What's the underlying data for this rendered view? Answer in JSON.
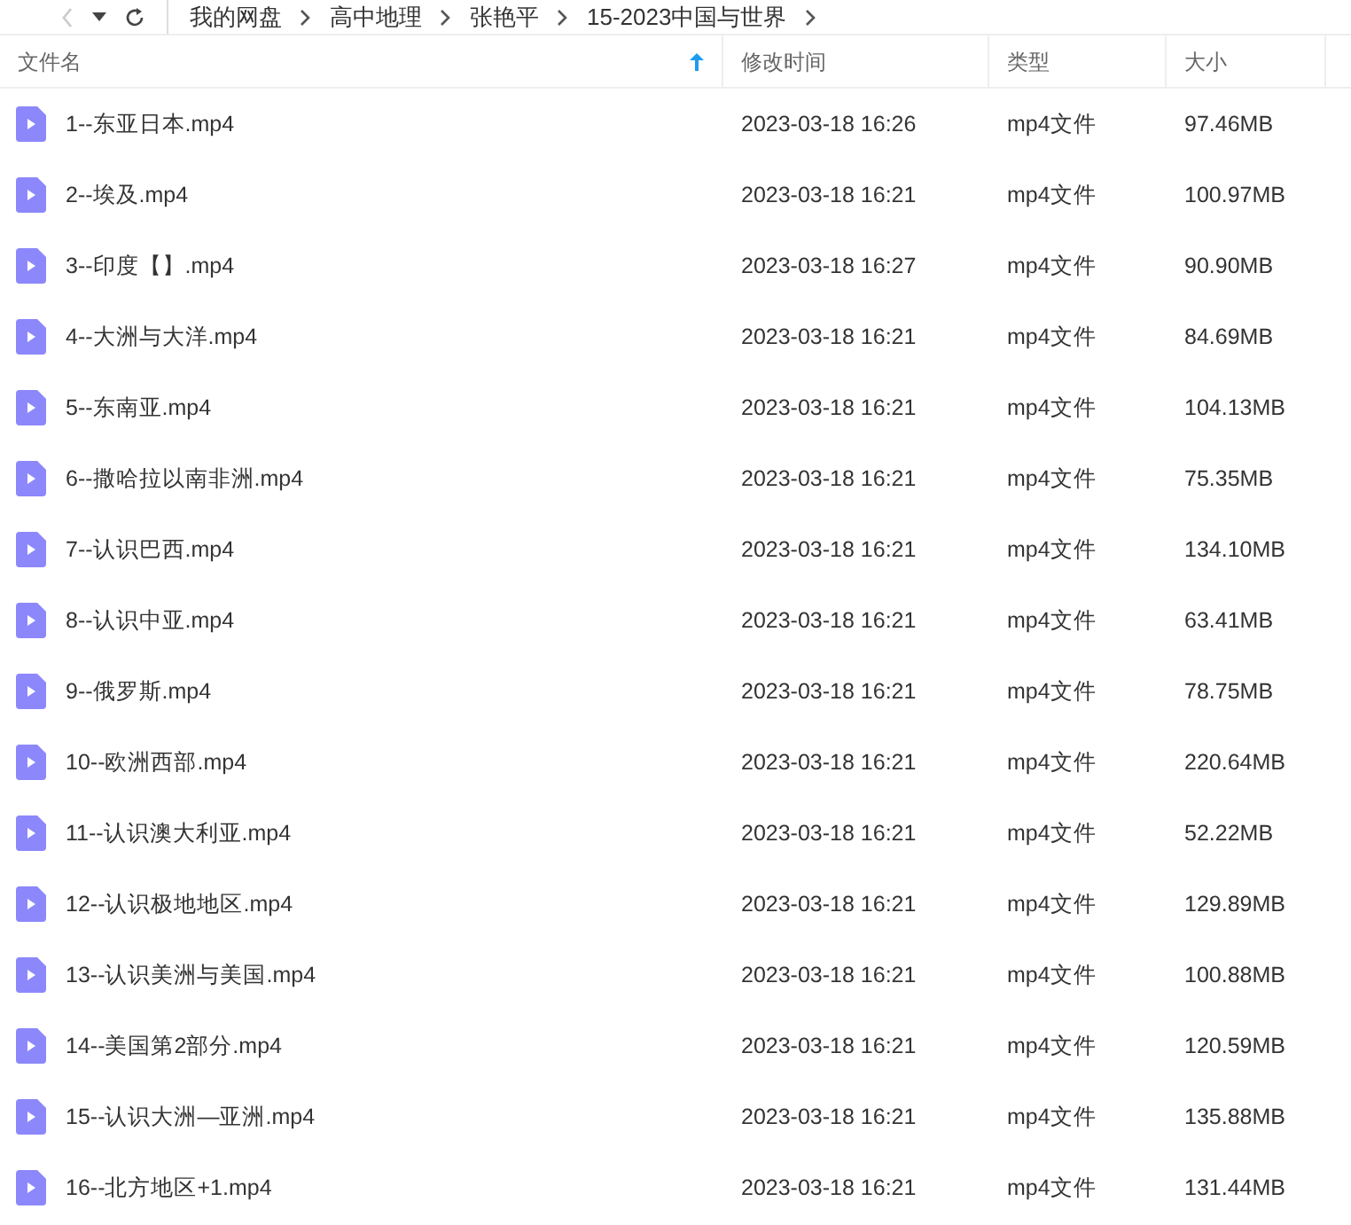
{
  "breadcrumb": [
    "我的网盘",
    "高中地理",
    "张艳平",
    "15-2023中国与世界"
  ],
  "columns": [
    {
      "label": "文件名",
      "sorted": true
    },
    {
      "label": "修改时间",
      "sorted": false
    },
    {
      "label": "类型",
      "sorted": false
    },
    {
      "label": "大小",
      "sorted": false
    }
  ],
  "rows": [
    {
      "name": "1--东亚日本.mp4",
      "modified": "2023-03-18 16:26",
      "type": "mp4文件",
      "size": "97.46MB"
    },
    {
      "name": "2--埃及.mp4",
      "modified": "2023-03-18 16:21",
      "type": "mp4文件",
      "size": "100.97MB"
    },
    {
      "name": "3--印度【】.mp4",
      "modified": "2023-03-18 16:27",
      "type": "mp4文件",
      "size": "90.90MB"
    },
    {
      "name": "4--大洲与大洋.mp4",
      "modified": "2023-03-18 16:21",
      "type": "mp4文件",
      "size": "84.69MB"
    },
    {
      "name": "5--东南亚.mp4",
      "modified": "2023-03-18 16:21",
      "type": "mp4文件",
      "size": "104.13MB"
    },
    {
      "name": "6--撒哈拉以南非洲.mp4",
      "modified": "2023-03-18 16:21",
      "type": "mp4文件",
      "size": "75.35MB"
    },
    {
      "name": "7--认识巴西.mp4",
      "modified": "2023-03-18 16:21",
      "type": "mp4文件",
      "size": "134.10MB"
    },
    {
      "name": "8--认识中亚.mp4",
      "modified": "2023-03-18 16:21",
      "type": "mp4文件",
      "size": "63.41MB"
    },
    {
      "name": "9--俄罗斯.mp4",
      "modified": "2023-03-18 16:21",
      "type": "mp4文件",
      "size": "78.75MB"
    },
    {
      "name": "10--欧洲西部.mp4",
      "modified": "2023-03-18 16:21",
      "type": "mp4文件",
      "size": "220.64MB"
    },
    {
      "name": "11--认识澳大利亚.mp4",
      "modified": "2023-03-18 16:21",
      "type": "mp4文件",
      "size": "52.22MB"
    },
    {
      "name": "12--认识极地地区.mp4",
      "modified": "2023-03-18 16:21",
      "type": "mp4文件",
      "size": "129.89MB"
    },
    {
      "name": "13--认识美洲与美国.mp4",
      "modified": "2023-03-18 16:21",
      "type": "mp4文件",
      "size": "100.88MB"
    },
    {
      "name": "14--美国第2部分.mp4",
      "modified": "2023-03-18 16:21",
      "type": "mp4文件",
      "size": "120.59MB"
    },
    {
      "name": "15--认识大洲—亚洲.mp4",
      "modified": "2023-03-18 16:21",
      "type": "mp4文件",
      "size": "135.88MB"
    },
    {
      "name": "16--北方地区+1.mp4",
      "modified": "2023-03-18 16:21",
      "type": "mp4文件",
      "size": "131.44MB"
    }
  ]
}
